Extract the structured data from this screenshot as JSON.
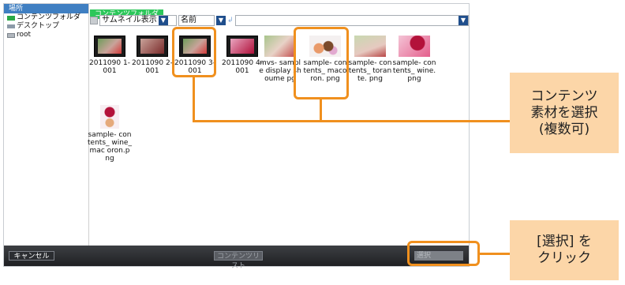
{
  "sidebar": {
    "header": "場所",
    "items": [
      {
        "label": "コンテンツフォルダ",
        "icon": "folder-icon"
      },
      {
        "label": "デスクトップ",
        "icon": "desktop-icon"
      },
      {
        "label": "root",
        "icon": "drive-icon"
      }
    ]
  },
  "tab": {
    "label": "コンテンツフォルダ"
  },
  "toolbar": {
    "view_mode": "サムネイル表示",
    "sort": "名前",
    "path": ""
  },
  "files": [
    {
      "name": "2011090 1-001"
    },
    {
      "name": "2011090 2-001"
    },
    {
      "name": "2011090 3-001"
    },
    {
      "name": "2011090 4-001"
    },
    {
      "name": "mvs- sample display shoume pg"
    },
    {
      "name": "sample- contents_ macoron. png"
    },
    {
      "name": "sample- contents_ torante. png"
    },
    {
      "name": "sample- contents_ wine.png"
    },
    {
      "name": "sample- contents_ wine_mac oron.png"
    }
  ],
  "buttons": {
    "cancel": "キャンセル",
    "middle": "コンテンツリスト",
    "select": "選択"
  },
  "callouts": {
    "select_content": [
      "コンテンツ",
      "素材を選択",
      "(複数可)"
    ],
    "click_select": [
      "[選択] を",
      "クリック"
    ]
  },
  "colors": {
    "accent_orange": "#f0901e",
    "callout_bg": "#fcd6a8",
    "tab_green": "#2cc75a",
    "header_blue": "#3f7fc2"
  }
}
